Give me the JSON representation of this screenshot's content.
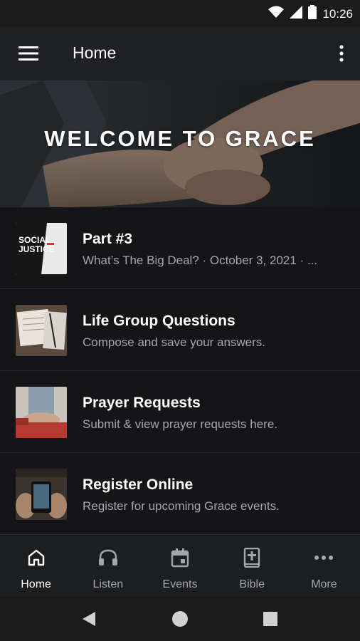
{
  "status_bar": {
    "time": "10:26",
    "icons": [
      "wifi-icon",
      "cell-signal-icon",
      "battery-icon"
    ]
  },
  "app_bar": {
    "title": "Home",
    "menu_icon": "hamburger-menu-icon",
    "overflow_icon": "more-vert-icon"
  },
  "hero": {
    "text": "WELCOME TO GRACE"
  },
  "list": [
    {
      "title": "Part #3",
      "subtitle": "What’s The Big Deal? · October 3, 2021 · ...",
      "thumbnail_text": [
        "SOCIAL",
        "JUSTICE"
      ]
    },
    {
      "title": "Life Group Questions",
      "subtitle": "Compose and save your answers."
    },
    {
      "title": "Prayer Requests",
      "subtitle": "Submit & view prayer requests here."
    },
    {
      "title": "Register Online",
      "subtitle": "Register for upcoming Grace events."
    }
  ],
  "bottom_nav": {
    "items": [
      {
        "label": "Home",
        "icon": "home-icon",
        "active": true
      },
      {
        "label": "Listen",
        "icon": "headphones-icon",
        "active": false
      },
      {
        "label": "Events",
        "icon": "calendar-icon",
        "active": false
      },
      {
        "label": "Bible",
        "icon": "bible-icon",
        "active": false
      },
      {
        "label": "More",
        "icon": "more-horiz-icon",
        "active": false
      }
    ]
  },
  "system_nav": [
    "back-icon",
    "home-circle-icon",
    "recents-icon"
  ],
  "colors": {
    "background": "#121213",
    "app_bar": "#1f2023",
    "subtitle_text": "#a5a6aa",
    "active_nav": "#ffffff"
  }
}
